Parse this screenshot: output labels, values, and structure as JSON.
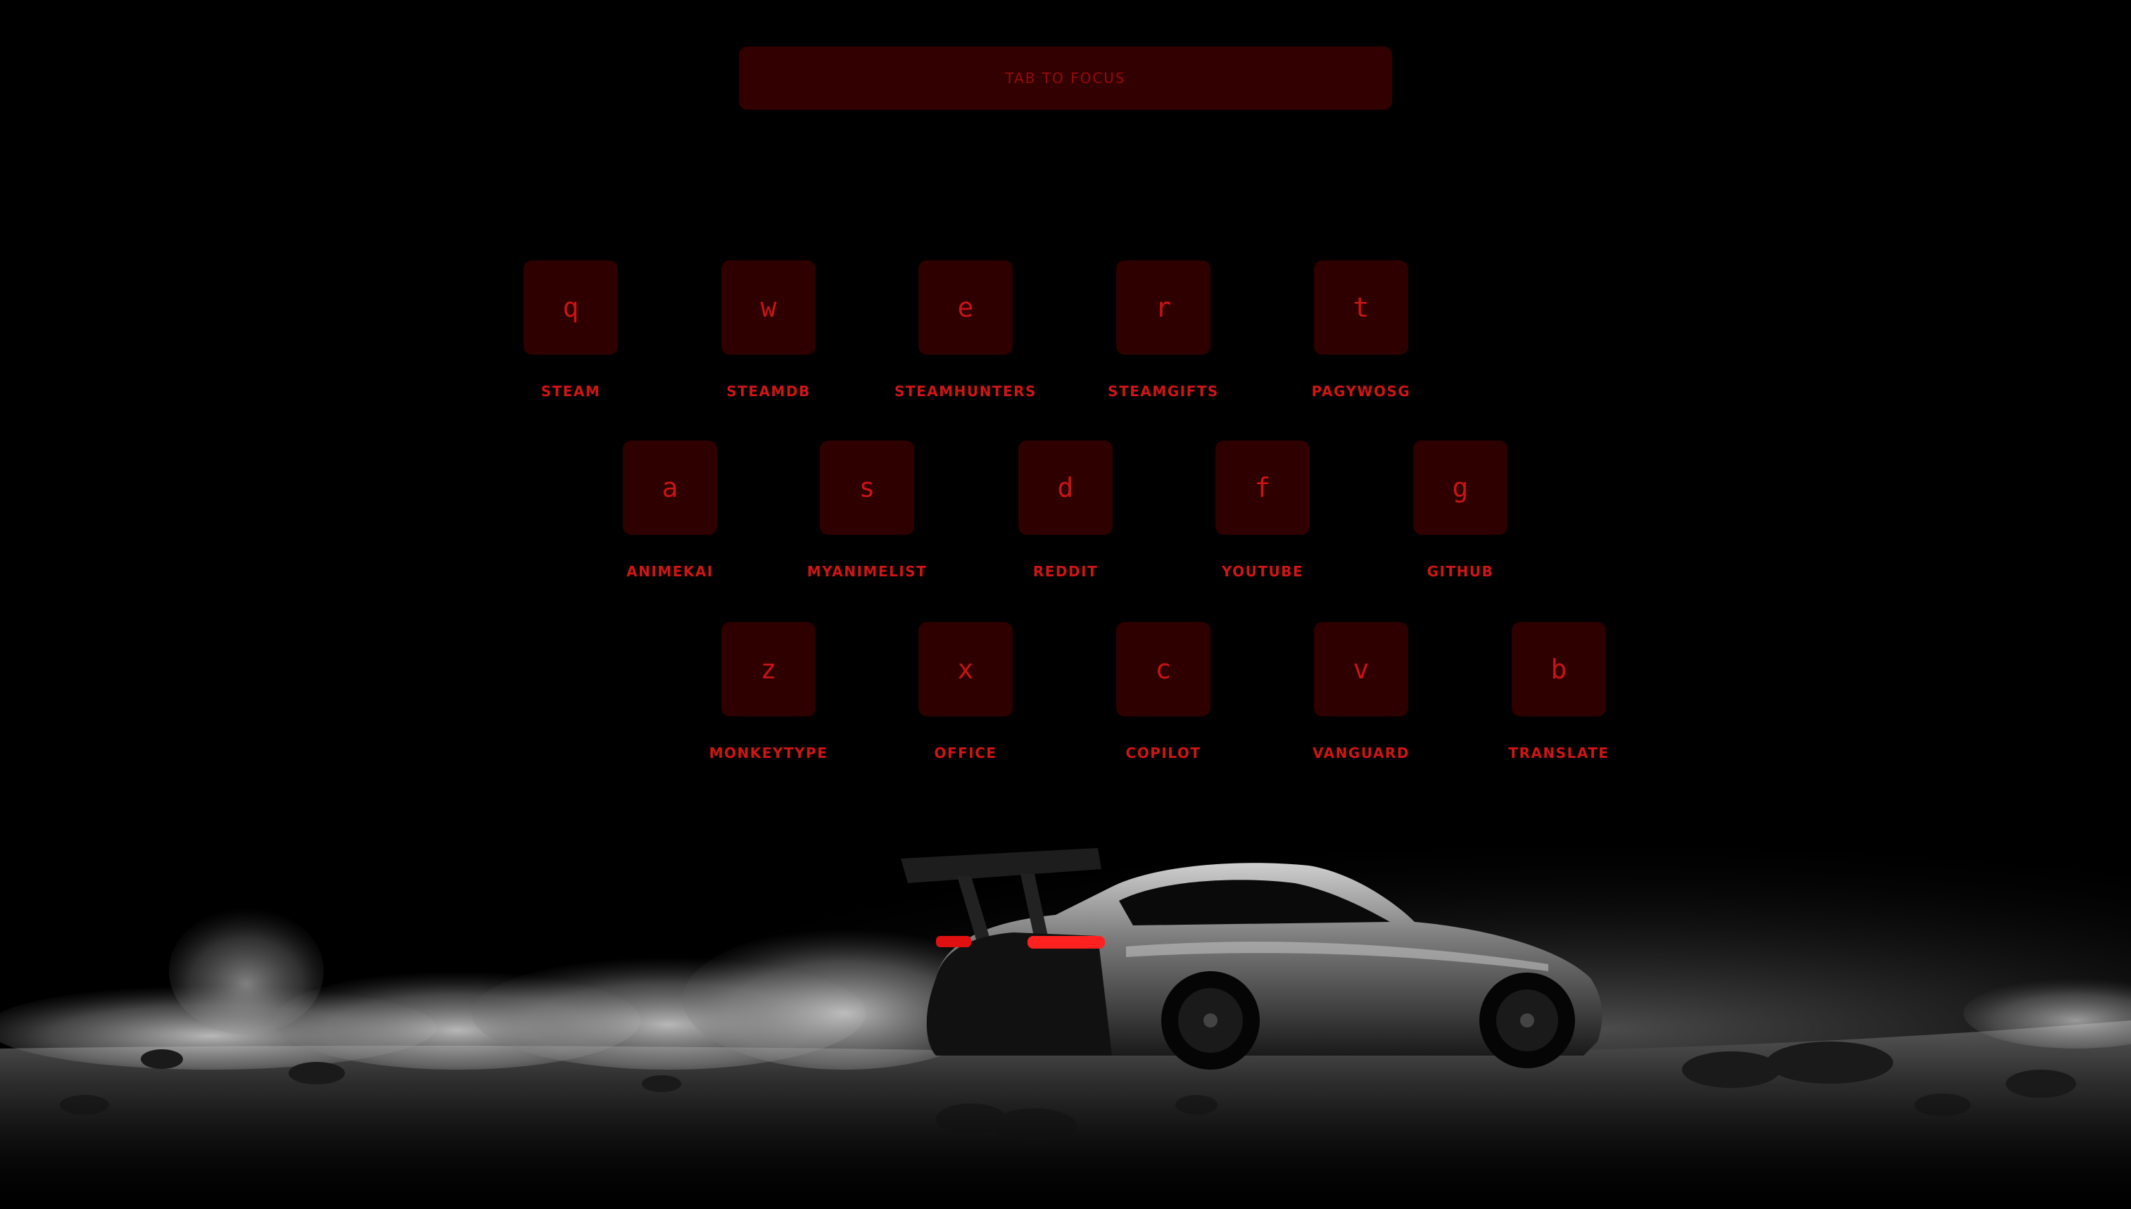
{
  "search": {
    "placeholder": "TAB TO FOCUS"
  },
  "rows": [
    [
      {
        "key": "q",
        "label": "STEAM"
      },
      {
        "key": "w",
        "label": "STEAMDB"
      },
      {
        "key": "e",
        "label": "STEAMHUNTERS"
      },
      {
        "key": "r",
        "label": "STEAMGIFTS"
      },
      {
        "key": "t",
        "label": "PAGYWOSG"
      }
    ],
    [
      {
        "key": "a",
        "label": "ANIMEKAI"
      },
      {
        "key": "s",
        "label": "MYANIMELIST"
      },
      {
        "key": "d",
        "label": "REDDIT"
      },
      {
        "key": "f",
        "label": "YOUTUBE"
      },
      {
        "key": "g",
        "label": "GITHUB"
      }
    ],
    [
      {
        "key": "z",
        "label": "MONKEYTYPE"
      },
      {
        "key": "x",
        "label": "OFFICE"
      },
      {
        "key": "c",
        "label": "COPILOT"
      },
      {
        "key": "v",
        "label": "VANGUARD"
      },
      {
        "key": "b",
        "label": "TRANSLATE"
      }
    ]
  ],
  "colors": {
    "background": "#000000",
    "keycap": "#2e0000",
    "accent": "#d01515",
    "search_bar": "#320000"
  }
}
